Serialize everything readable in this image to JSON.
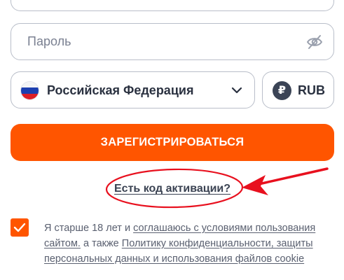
{
  "form": {
    "password_placeholder": "Пароль",
    "country": {
      "label": "Российская Федерация",
      "flag": "ru-flag"
    },
    "currency": {
      "symbol": "₽",
      "label": "RUB"
    },
    "register_button": "ЗАРЕГИСТРИРОВАТЬСЯ",
    "activation_link": "Есть код активации?",
    "agreement": {
      "checked": true,
      "text_1": "Я старше 18 лет и ",
      "link_1": "соглашаюсь с условиями пользования сайтом.",
      "text_2": " а также ",
      "link_2": "Политику конфиденциальности, защиты персональных данных и использования файлов cookie"
    }
  },
  "colors": {
    "accent": "#ff5500",
    "border": "#b9bec9",
    "text": "#2a3140",
    "annotation": "#e8101e"
  },
  "icons": [
    "eye-slash-icon",
    "ru-flag-icon",
    "chevron-down-icon",
    "ruble-icon",
    "checkmark-icon",
    "arrow-annotation"
  ]
}
